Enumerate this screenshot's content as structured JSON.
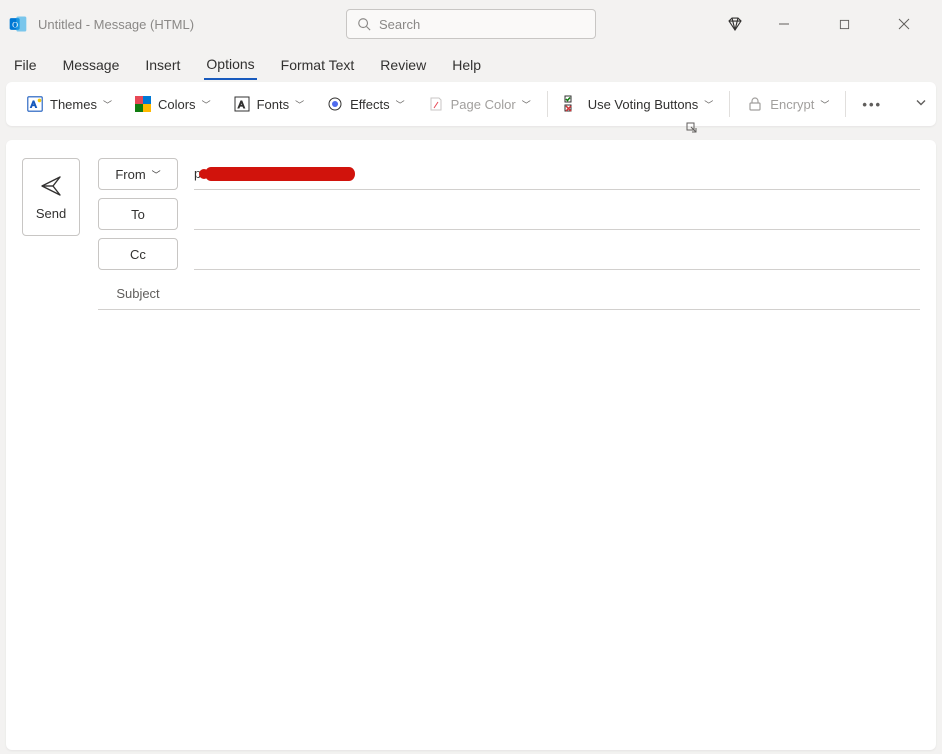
{
  "titlebar": {
    "title": "Untitled  -  Message (HTML)",
    "search_placeholder": "Search"
  },
  "menu": {
    "items": [
      "File",
      "Message",
      "Insert",
      "Options",
      "Format Text",
      "Review",
      "Help"
    ],
    "active_index": 3
  },
  "ribbon": {
    "themes": "Themes",
    "colors": "Colors",
    "fonts": "Fonts",
    "effects": "Effects",
    "page_color": "Page Color",
    "voting": "Use Voting Buttons",
    "encrypt": "Encrypt"
  },
  "compose": {
    "send": "Send",
    "from": "From",
    "to": "To",
    "cc": "Cc",
    "subject_label": "Subject",
    "from_value": "[redacted]",
    "to_value": "",
    "cc_value": "",
    "subject_value": "",
    "body_value": ""
  }
}
